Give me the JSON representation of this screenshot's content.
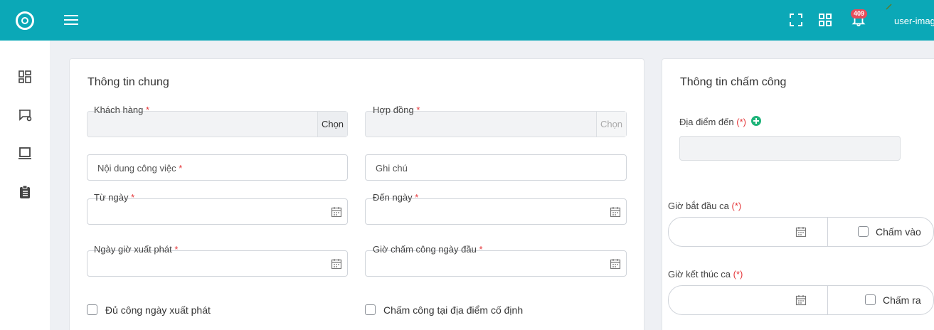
{
  "topbar": {
    "badge_count": "409",
    "user_name": "user-imag",
    "icons": [
      "logo-icon",
      "menu-icon",
      "fullscreen-icon",
      "apps-grid-icon",
      "bell-icon"
    ]
  },
  "sidebar": {
    "icons": [
      "dashboard-icon",
      "monitor-settings-icon",
      "laptop-icon",
      "clipboard-icon"
    ]
  },
  "general": {
    "title": "Thông tin chung",
    "customer_label": "Khách hàng",
    "contract_label": "Hợp đồng",
    "choose_label": "Chọn",
    "choose_label_disabled": "Chọn",
    "work_content_placeholder": "Nội dung công việc",
    "note_placeholder": "Ghi chú",
    "from_date_label": "Từ ngày",
    "to_date_label": "Đến ngày",
    "departure_label": "Ngày giờ xuất phát",
    "first_day_checkin_label": "Giờ chấm công ngày đầu",
    "full_day_departure_label": "Đủ công ngày xuất phát",
    "fixed_location_label": "Chấm công tại địa điểm cố định",
    "required_mark": "*"
  },
  "attendance": {
    "title": "Thông tin chấm công",
    "destination_label": "Địa điểm đến",
    "shift_start_label": "Giờ bắt đầu ca",
    "shift_end_label": "Giờ kết thúc ca",
    "required_mark_paren": "(*)",
    "check_in_label": "Chấm vào",
    "check_out_label": "Chấm ra"
  },
  "colors": {
    "topbar": "#0ba8b7",
    "required": "#e5383b",
    "badge": "#e74c5a",
    "add": "#1fb47a"
  }
}
